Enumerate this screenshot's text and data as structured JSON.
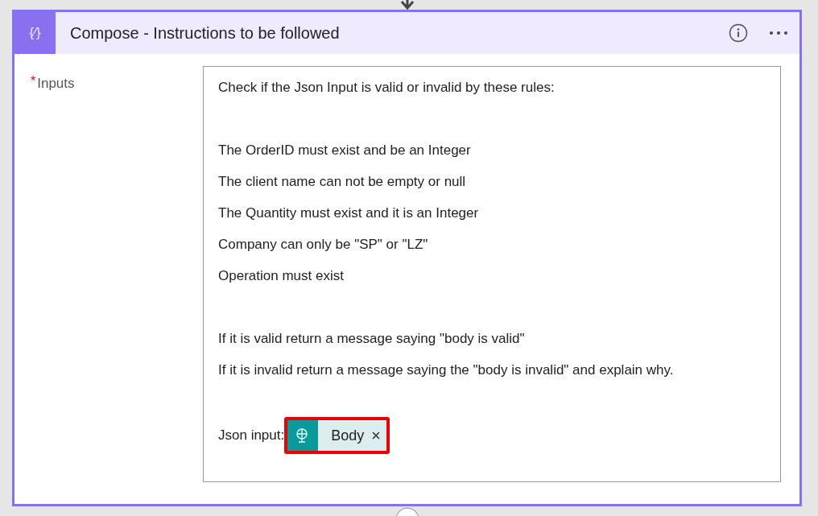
{
  "card": {
    "title": "Compose - Instructions to be followed",
    "icon": "{∕}"
  },
  "inputs": {
    "required_mark": "*",
    "label": "Inputs",
    "paragraphs": [
      [
        "Check if the Json Input is valid or invalid by these rules:"
      ],
      [
        "The OrderID must exist and be an Integer",
        "The client name can not be empty or null",
        "The Quantity must exist and it is an Integer",
        "Company can only be \"SP\" or \"LZ\"",
        "Operation must exist"
      ],
      [
        "If it is valid return a message saying \"body is valid\"",
        "If it is invalid return a message saying the \"body is invalid\" and explain why."
      ]
    ],
    "last_line": {
      "text": "Json input:",
      "token": {
        "label": "Body",
        "highlighted": true
      }
    }
  }
}
